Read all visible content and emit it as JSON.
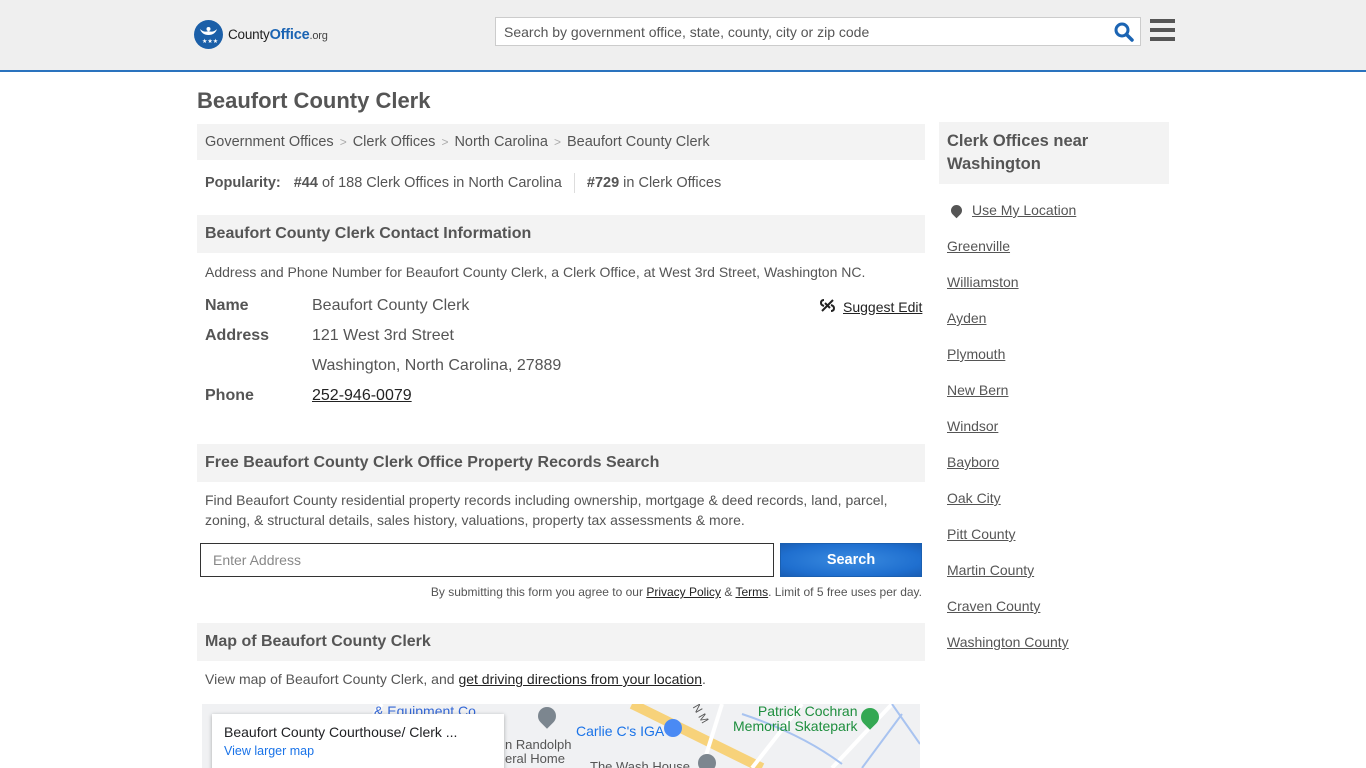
{
  "header": {
    "logo": {
      "brand_plain": "County",
      "brand_bold": "Office",
      "brand_tld": ".org"
    },
    "search_placeholder": "Search by government office, state, county, city or zip code",
    "search_icon": "search-icon",
    "menu_icon": "hamburger-menu-icon"
  },
  "page_title": "Beaufort County Clerk",
  "breadcrumb": [
    {
      "label": "Government Offices"
    },
    {
      "label": "Clerk Offices"
    },
    {
      "label": "North Carolina"
    },
    {
      "label": "Beaufort County Clerk"
    }
  ],
  "breadcrumb_separator": ">",
  "popularity": {
    "label": "Popularity:",
    "state_rank": "#44",
    "state_text": "of 188 Clerk Offices in North Carolina",
    "national_rank": "#729",
    "national_text": "in Clerk Offices"
  },
  "contact": {
    "heading": "Beaufort County Clerk Contact Information",
    "description": "Address and Phone Number for Beaufort County Clerk, a Clerk Office, at West 3rd Street, Washington NC.",
    "suggest_edit": "Suggest Edit",
    "name_label": "Name",
    "name_value": "Beaufort County Clerk",
    "address_label": "Address",
    "address_line1": "121 West 3rd Street",
    "address_line2": "Washington, North Carolina, 27889",
    "phone_label": "Phone",
    "phone_value": "252-946-0079"
  },
  "property": {
    "heading": "Free Beaufort County Clerk Office Property Records Search",
    "description_line1": "Find Beaufort County residential property records including ownership, mortgage & deed records, land, parcel,",
    "description_line2": "zoning, & structural details, sales history, valuations, property tax assessments & more.",
    "address_placeholder": "Enter Address",
    "search_button": "Search",
    "disclaimer_prefix": "By submitting this form you agree to our ",
    "privacy_link": "Privacy Policy",
    "disclaimer_amp": " & ",
    "terms_link": "Terms",
    "disclaimer_suffix": ". Limit of 5 free uses per day."
  },
  "map_section": {
    "heading": "Map of Beaufort County Clerk",
    "description_prefix": "View map of Beaufort County Clerk, and ",
    "directions_link": "get driving directions from your location",
    "description_suffix": ".",
    "card_title": "Beaufort County Courthouse/ Clerk ...",
    "card_link": "View larger map",
    "labels": {
      "equipment": "& Equipment Co.",
      "randolph1": "n Randolph",
      "randolph2": "eral Home",
      "carlie": "Carlie C's IGA",
      "street": "N M",
      "skate1": "Patrick Cochran",
      "skate2": "Memorial Skatepark",
      "wash": "The Wash House"
    }
  },
  "sidebar": {
    "heading": "Clerk Offices near Washington",
    "use_location": "Use My Location",
    "links": [
      "Greenville",
      "Williamston",
      "Ayden",
      "Plymouth",
      "New Bern",
      "Windsor",
      "Bayboro",
      "Oak City",
      "Pitt County",
      "Martin County",
      "Craven County",
      "Washington County"
    ]
  }
}
